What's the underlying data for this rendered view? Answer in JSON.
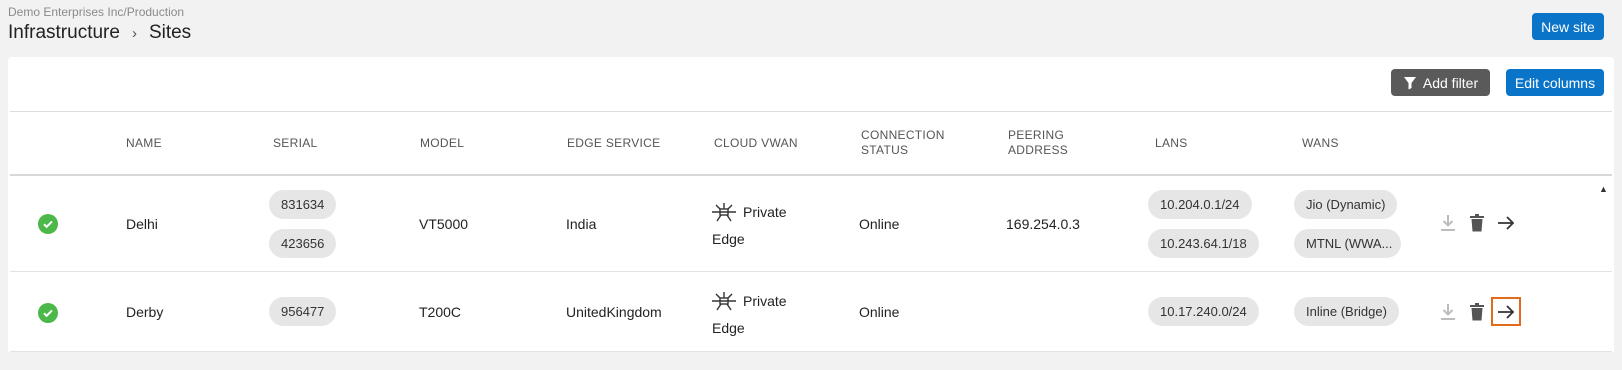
{
  "breadcrumb": {
    "org": "Demo Enterprises Inc/Production",
    "parent": "Infrastructure",
    "separator": "›",
    "current": "Sites"
  },
  "toolbar": {
    "new_site_label": "New site",
    "add_filter_label": "Add filter",
    "edit_columns_label": "Edit columns"
  },
  "table": {
    "columns": [
      "NAME",
      "SERIAL",
      "MODEL",
      "EDGE SERVICE",
      "CLOUD VWAN",
      "CONNECTION STATUS",
      "PEERING ADDRESS",
      "LANS",
      "WANS"
    ],
    "column_lines": {
      "connection": [
        "CONNECTION",
        "STATUS"
      ],
      "peering": [
        "PEERING",
        "ADDRESS"
      ]
    },
    "rows": [
      {
        "name": "Delhi",
        "serials": [
          "831634",
          "423656"
        ],
        "model": "VT5000",
        "edge_service": "India",
        "cloud_vwan_line1": "Private",
        "cloud_vwan_line2": "Edge",
        "connection_status": "Online",
        "peering_address": "169.254.0.3",
        "lans": [
          "10.204.0.1/24",
          "10.243.64.1/18"
        ],
        "wans": [
          "Jio (Dynamic)",
          "MTNL (WWA..."
        ]
      },
      {
        "name": "Derby",
        "serials": [
          "956477"
        ],
        "model": "T200C",
        "edge_service": "UnitedKingdom",
        "cloud_vwan_line1": "Private",
        "cloud_vwan_line2": "Edge",
        "connection_status": "Online",
        "peering_address": "",
        "lans": [
          "10.17.240.0/24"
        ],
        "wans": [
          "Inline (Bridge)"
        ]
      }
    ]
  },
  "icons": {
    "status": "check-circle-icon",
    "filter": "filter-icon",
    "edge": "satellite-icon",
    "download": "download-icon",
    "delete": "trash-icon",
    "open": "arrow-right-icon"
  },
  "colors": {
    "primary": "#0a74c9",
    "filter_button": "#5a5a5a",
    "online": "#4cb84a",
    "focus": "#e26a1b"
  }
}
